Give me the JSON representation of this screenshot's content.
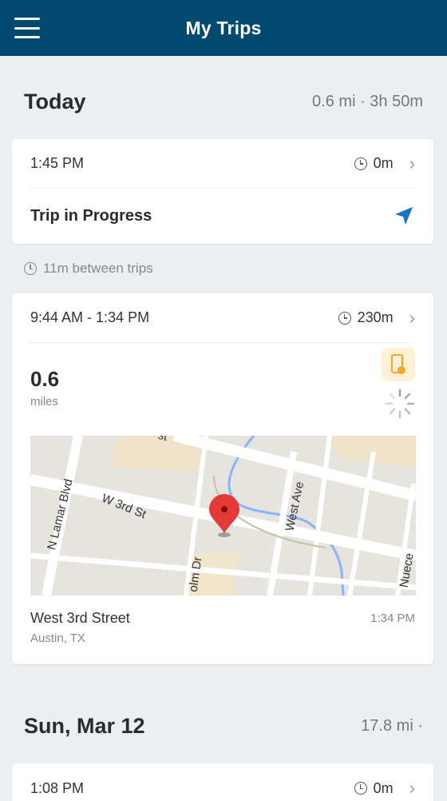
{
  "header": {
    "title": "My Trips"
  },
  "days": [
    {
      "title": "Today",
      "summary": "0.6 mi · 3h 50m",
      "trips": [
        {
          "time": "1:45 PM",
          "duration": "0m",
          "status": "Trip in Progress"
        }
      ],
      "gap": "11m between trips",
      "trip2": {
        "time": "9:44 AM - 1:34 PM",
        "duration": "230m",
        "distance": "0.6",
        "distance_unit": "miles",
        "address": "West 3rd Street",
        "city": "Austin, TX",
        "end_time": "1:34 PM",
        "map_labels": {
          "street1": "W 3rd St",
          "street2": "N Lamar Blvd",
          "street3": "West Ave",
          "street4": "olm Dr",
          "street5": "Nuece",
          "street6": "st"
        }
      }
    },
    {
      "title": "Sun, Mar 12",
      "summary": "17.8 mi ·",
      "trips": [
        {
          "time": "1:08 PM",
          "duration": "0m"
        }
      ]
    }
  ],
  "colors": {
    "header_bg": "#004a70",
    "accent_blue": "#1a73c8",
    "badge_orange": "#f5a623",
    "pin_red": "#e53935"
  },
  "icons": {
    "menu": "hamburger-menu-icon",
    "clock": "clock-icon",
    "chevron": "chevron-right-icon",
    "navigation": "navigation-arrow-icon",
    "phone": "phone-icon",
    "spinner": "loading-spinner-icon",
    "pin": "map-pin-icon"
  }
}
